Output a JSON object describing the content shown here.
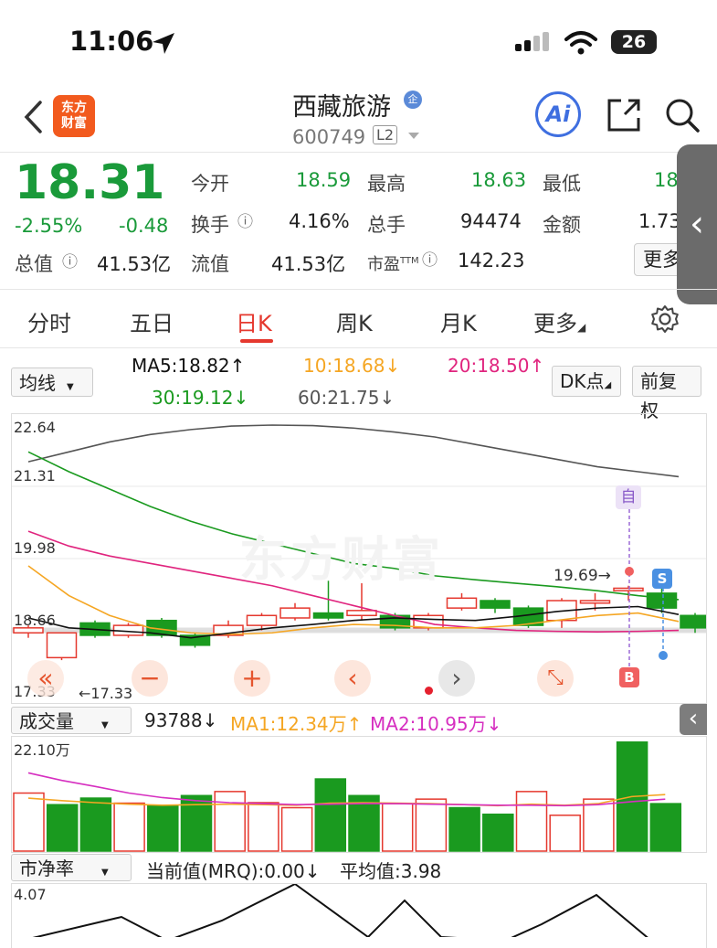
{
  "status_bar": {
    "time": "11:06",
    "battery": "26"
  },
  "header": {
    "app_logo": "东方\n财富",
    "stock_name": "西藏旅游",
    "name_badge": "企",
    "stock_code": "600749",
    "level_badge": "L2",
    "ai_label": "Ai"
  },
  "quote": {
    "price": "18.31",
    "change_pct": "-2.55%",
    "change": "-0.48",
    "open_label": "今开",
    "open": "18.59",
    "high_label": "最高",
    "high": "18.63",
    "low_label": "最低",
    "low": "18",
    "turnover_label": "换手",
    "turnover": "4.16%",
    "volume_label": "总手",
    "volume": "94474",
    "amount_label": "金额",
    "amount": "1.73",
    "mktcap_label": "总值",
    "mktcap": "41.53亿",
    "float_label": "流值",
    "float_cap": "41.53亿",
    "pe_label": "市盈",
    "pe_sup": "TTM",
    "pe": "142.23",
    "more_label": "更多"
  },
  "tabs": [
    "分时",
    "五日",
    "日K",
    "周K",
    "月K",
    "更多"
  ],
  "active_tab": 2,
  "ma_bar": {
    "selector": "均线",
    "ma5": "MA5:18.82↑",
    "ma10": "10:18.68↓",
    "ma20": "20:18.50↑",
    "ma30": "30:19.12↓",
    "ma60": "60:21.75↓",
    "dk_label": "DK点",
    "adjust_label": "前复权"
  },
  "kline": {
    "y_ticks": [
      "22.64",
      "21.31",
      "19.98",
      "18.66",
      "17.33"
    ],
    "min_marker": "←17.33",
    "max_marker": "19.69→",
    "watermark": "东方财富",
    "tag_self": "自",
    "tag_sell": "S",
    "tag_buy": "B"
  },
  "chart_data": {
    "type": "candlestick",
    "y_range": [
      17.33,
      22.64
    ],
    "candles": [
      {
        "o": 18.55,
        "c": 18.45,
        "h": 18.6,
        "l": 18.35,
        "up": true
      },
      {
        "o": 18.45,
        "c": 17.95,
        "h": 18.45,
        "l": 17.9,
        "up": true
      },
      {
        "o": 18.65,
        "c": 18.4,
        "h": 18.7,
        "l": 18.35,
        "up": false
      },
      {
        "o": 18.4,
        "c": 18.6,
        "h": 18.65,
        "l": 18.35,
        "up": true
      },
      {
        "o": 18.7,
        "c": 18.4,
        "h": 18.75,
        "l": 18.35,
        "up": false
      },
      {
        "o": 18.4,
        "c": 18.2,
        "h": 18.45,
        "l": 18.15,
        "up": false
      },
      {
        "o": 18.4,
        "c": 18.6,
        "h": 18.7,
        "l": 18.35,
        "up": true
      },
      {
        "o": 18.6,
        "c": 18.8,
        "h": 18.85,
        "l": 18.5,
        "up": true
      },
      {
        "o": 18.75,
        "c": 18.95,
        "h": 19.05,
        "l": 18.7,
        "up": true
      },
      {
        "o": 18.85,
        "c": 18.75,
        "h": 19.5,
        "l": 18.7,
        "up": false
      },
      {
        "o": 18.8,
        "c": 18.9,
        "h": 19.45,
        "l": 18.7,
        "up": true
      },
      {
        "o": 18.8,
        "c": 18.55,
        "h": 18.85,
        "l": 18.5,
        "up": false
      },
      {
        "o": 18.55,
        "c": 18.8,
        "h": 18.85,
        "l": 18.5,
        "up": true
      },
      {
        "o": 18.95,
        "c": 19.15,
        "h": 19.25,
        "l": 18.9,
        "up": true
      },
      {
        "o": 19.1,
        "c": 18.95,
        "h": 19.15,
        "l": 18.85,
        "up": false
      },
      {
        "o": 18.95,
        "c": 18.6,
        "h": 19.0,
        "l": 18.55,
        "up": false
      },
      {
        "o": 18.7,
        "c": 19.1,
        "h": 19.15,
        "l": 18.55,
        "up": true
      },
      {
        "o": 19.05,
        "c": 19.1,
        "h": 19.25,
        "l": 18.9,
        "up": true
      },
      {
        "o": 19.3,
        "c": 19.35,
        "h": 19.4,
        "l": 19.1,
        "up": true
      },
      {
        "o": 19.25,
        "c": 18.95,
        "h": 19.69,
        "l": 18.85,
        "up": false
      },
      {
        "o": 18.8,
        "c": 18.55,
        "h": 18.85,
        "l": 18.45,
        "up": false
      }
    ],
    "volume": {
      "max_label": "22.10万",
      "bars": [
        11.5,
        9.2,
        10.5,
        9.5,
        9.0,
        11.0,
        11.8,
        9.6,
        8.6,
        14.3,
        11.0,
        9.4,
        10.3,
        8.6,
        7.3,
        11.8,
        7.1,
        10.3,
        21.6,
        9.4
      ],
      "up": [
        true,
        false,
        false,
        true,
        false,
        false,
        true,
        true,
        true,
        false,
        false,
        true,
        true,
        false,
        false,
        true,
        true,
        true,
        false,
        false
      ]
    }
  },
  "volume_bar": {
    "selector": "成交量",
    "value": "93788↓",
    "ma1": "MA1:12.34万↑",
    "ma2": "MA2:10.95万↓"
  },
  "pb_bar": {
    "selector": "市净率",
    "current": "当前值(MRQ):0.00↓",
    "avg": "平均值:3.98",
    "y_tick": "4.07"
  },
  "colors": {
    "up": "#e5382e",
    "down": "#1a9a1f",
    "accent": "#e5382e",
    "ma5": "#111111",
    "ma10": "#f5a623",
    "ma20": "#e0247e",
    "ma30": "#1a9a1f",
    "ma60": "#555555"
  }
}
